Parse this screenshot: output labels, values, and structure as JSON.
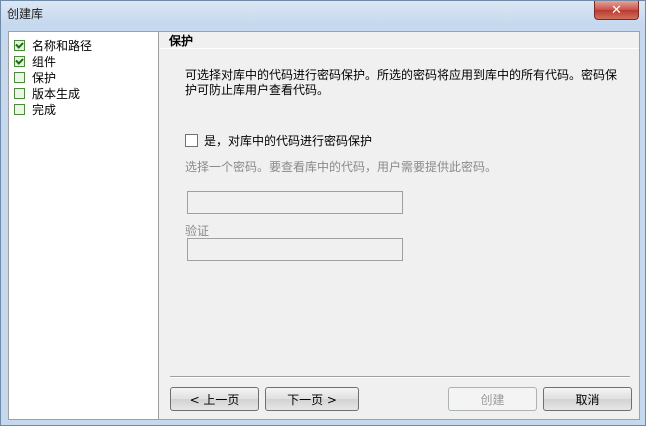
{
  "window": {
    "title": "创建库",
    "close_glyph": "✕"
  },
  "sidebar": {
    "steps": [
      {
        "label": "名称和路径",
        "checked": true
      },
      {
        "label": "组件",
        "checked": true
      },
      {
        "label": "保护",
        "checked": false
      },
      {
        "label": "版本生成",
        "checked": false
      },
      {
        "label": "完成",
        "checked": false
      }
    ]
  },
  "panel": {
    "title": "保护",
    "description": "可选择对库中的代码进行密码保护。所选的密码将应用到库中的所有代码。密码保护可防止库用户查看代码。",
    "protect_checkbox_label": "是，对库中的代码进行密码保护",
    "protect_checked": false,
    "password_hint": "选择一个密码。要查看库中的代码，用户需要提供此密码。",
    "password_value": "",
    "verify_label": "验证",
    "verify_value": ""
  },
  "buttons": {
    "prev": "< 上一页",
    "next": "下一页 >",
    "create": "创建",
    "cancel": "取消"
  }
}
